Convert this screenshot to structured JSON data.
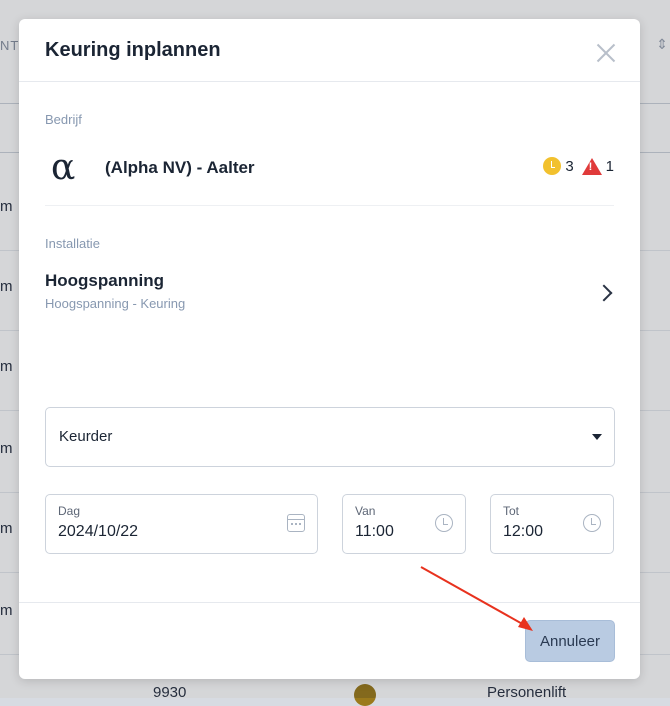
{
  "background": {
    "header_fragment": "NTI",
    "row_cells": [
      "m",
      "m",
      "m",
      "m",
      "m",
      "m"
    ],
    "bottom_row": {
      "number": "9930",
      "type": "Personenlift"
    }
  },
  "modal": {
    "title": "Keuring inplannen",
    "company": {
      "section_label": "Bedrijf",
      "logo_glyph": "α",
      "name": "(Alpha NV) - Aalter",
      "pending_count": "3",
      "warning_count": "1"
    },
    "installation": {
      "section_label": "Installatie",
      "title": "Hoogspanning",
      "subtitle": "Hoogspanning - Keuring"
    },
    "inspector_select": {
      "label": "Keurder"
    },
    "date_field": {
      "label": "Dag",
      "value": "2024/10/22"
    },
    "from_field": {
      "label": "Van",
      "value": "11:00"
    },
    "to_field": {
      "label": "Tot",
      "value": "12:00"
    },
    "footer": {
      "cancel_label": "Annuleer"
    }
  },
  "colors": {
    "accent_button": "#b9cbe2",
    "warning_red": "#e03a3a",
    "pending_yellow": "#f2c12e",
    "annotation_arrow": "#e8321e"
  }
}
